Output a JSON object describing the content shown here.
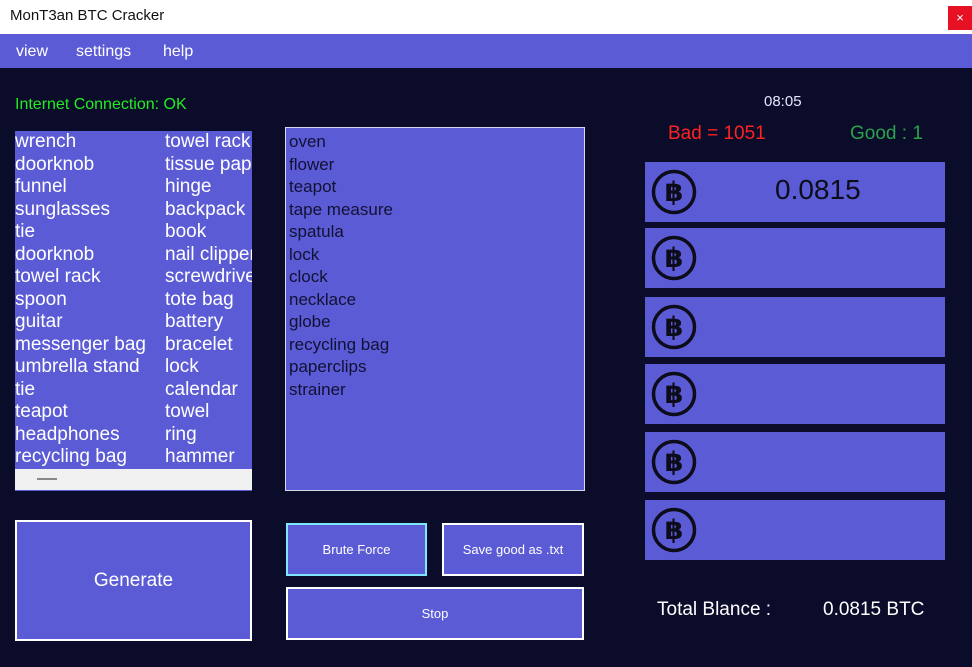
{
  "window": {
    "title": "MonT3an BTC Cracker",
    "close_glyph": "×"
  },
  "menu": [
    "view",
    "settings",
    "help"
  ],
  "status": {
    "connection": "Internet Connection: OK"
  },
  "word_list": {
    "col1": [
      "wrench",
      "doorknob",
      "funnel",
      "sunglasses",
      "tie",
      "doorknob",
      "towel rack",
      "spoon",
      "guitar",
      "messenger bag",
      "umbrella stand",
      "tie",
      "teapot",
      "headphones",
      "recycling bag"
    ],
    "col2": [
      "towel rack",
      "tissue paper",
      "hinge",
      "backpack",
      "book",
      "nail clippers",
      "screwdriver",
      "tote bag",
      "battery",
      "bracelet",
      "lock",
      "calendar",
      "towel",
      "ring",
      "hammer"
    ]
  },
  "middle_list": [
    "oven",
    "flower",
    "teapot",
    "tape measure",
    "spatula",
    "lock",
    "clock",
    "necklace",
    "globe",
    "recycling bag",
    "paperclips",
    "strainer"
  ],
  "buttons": {
    "generate": "Generate",
    "brute_force": "Brute Force",
    "save_good": "Save good as .txt",
    "stop": "Stop"
  },
  "stats": {
    "time": "08:05",
    "bad": "Bad = 1051",
    "good": "Good : 1"
  },
  "btc_rows": [
    {
      "value": "0.0815"
    },
    {
      "value": ""
    },
    {
      "value": ""
    },
    {
      "value": ""
    },
    {
      "value": ""
    },
    {
      "value": ""
    }
  ],
  "total": {
    "label": "Total Blance :",
    "value": "0.0815 BTC"
  },
  "icons": {
    "btc": "bitcoin-icon"
  },
  "colors": {
    "accent": "#5b5bd6",
    "background": "#0b0b2a",
    "ok": "#22ee22",
    "bad": "#ff2222",
    "good": "#2aa34a"
  }
}
